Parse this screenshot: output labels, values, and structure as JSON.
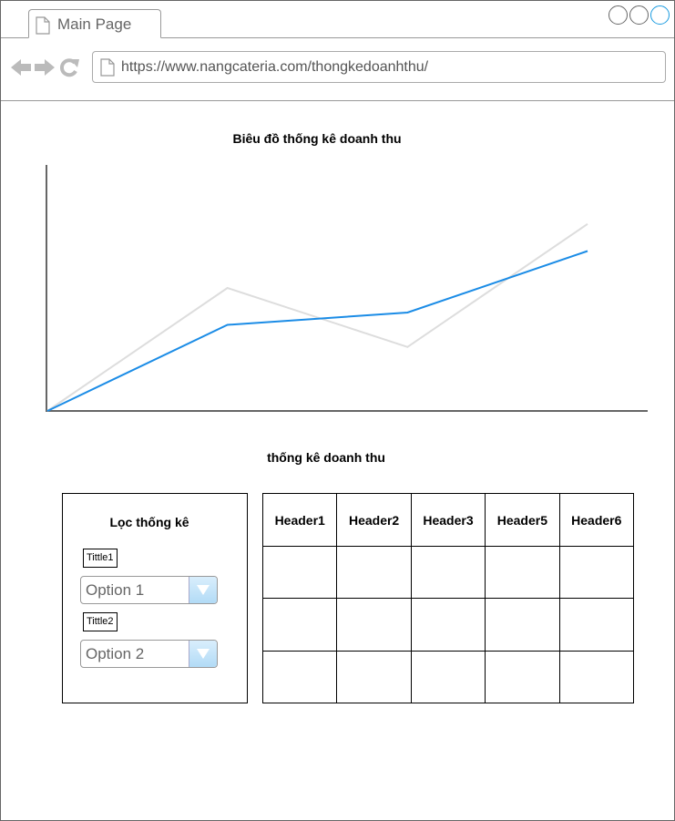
{
  "browser": {
    "tab_title": "Main Page",
    "url": "https://www.nangcateria.com/thongkedoanhthu/"
  },
  "chart_data": {
    "type": "line",
    "title": "Biêu đồ thống kê doanh thu",
    "xlabel": "",
    "ylabel": "",
    "x": [
      0,
      1,
      2,
      3
    ],
    "ylim": [
      0,
      100
    ],
    "series": [
      {
        "values": [
          0,
          35,
          40,
          65
        ],
        "color": "#1b8ce6"
      },
      {
        "values": [
          0,
          50,
          26,
          76
        ],
        "color": "#dddddd"
      }
    ]
  },
  "section": {
    "title": "thống kê doanh thu"
  },
  "filter": {
    "title": "Lọc thống kê",
    "field1": {
      "label": "Tittle1",
      "value": "Option 1"
    },
    "field2": {
      "label": "Tittle2",
      "value": "Option 2"
    }
  },
  "table": {
    "headers": [
      "Header1",
      "Header2",
      "Header3",
      "Header5",
      "Header6"
    ],
    "row_count": 3
  }
}
